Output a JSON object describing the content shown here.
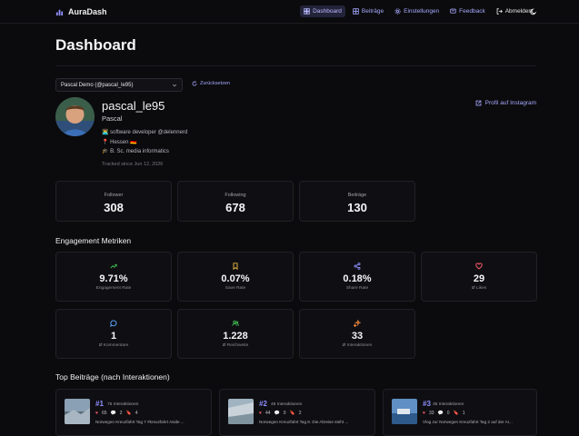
{
  "nav": {
    "brand": "AuraDash",
    "links": [
      {
        "label": "Dashboard",
        "icon": "dashboard-icon"
      },
      {
        "label": "Beiträge",
        "icon": "grid-icon"
      },
      {
        "label": "Einstellungen",
        "icon": "gear-icon"
      },
      {
        "label": "Feedback",
        "icon": "message-icon"
      },
      {
        "label": "Abmelden",
        "icon": "logout-icon"
      }
    ],
    "theme_icon": "moon-icon"
  },
  "page_title": "Dashboard",
  "account_select": {
    "value": "Pascal Demo (@pascal_le95)"
  },
  "reset_label": "Zurücksetzen",
  "profile": {
    "username": "pascal_le95",
    "name": "Pascal",
    "bio": [
      "👨‍💻 software developer @delennerd",
      "📍 Hessen 🇩🇪",
      "🎓 B. Sc. media informatics"
    ],
    "tracked": "Tracked since Jun 12, 2026",
    "instagram_link": "Profil auf Instagram"
  },
  "stats": [
    {
      "label": "Follower",
      "value": "308"
    },
    {
      "label": "Following",
      "value": "678"
    },
    {
      "label": "Beiträge",
      "value": "130"
    }
  ],
  "engagement_title": "Engagement Metriken",
  "metrics": [
    {
      "label": "Engagement Rate",
      "value": "9.71%",
      "icon": "trend-up-icon",
      "color": "#3fb950"
    },
    {
      "label": "Save Rate",
      "value": "0.07%",
      "icon": "bookmark-icon",
      "color": "#e3b341"
    },
    {
      "label": "Share Rate",
      "value": "0.18%",
      "icon": "share-icon",
      "color": "#8f90ff"
    },
    {
      "label": "Ø Likes",
      "value": "29",
      "icon": "heart-icon",
      "color": "#ff5a6a"
    },
    {
      "label": "Ø Kommentare",
      "value": "1",
      "icon": "comment-icon",
      "color": "#58a6ff"
    },
    {
      "label": "Ø Reichweite",
      "value": "1.228",
      "icon": "users-icon",
      "color": "#3fb950"
    },
    {
      "label": "Ø Interaktionen",
      "value": "33",
      "icon": "sparkle-icon",
      "color": "#f0883e"
    }
  ],
  "top_posts_title": "Top Beiträge (nach Interaktionen)",
  "posts": [
    {
      "rank": "#1",
      "interactions": "75 Interaktionen",
      "likes": "65",
      "comments": "2",
      "saves": "4",
      "title": "Norwegen Kreuzfahrt Tag 7 #kreuzfahrt Aside ..."
    },
    {
      "rank": "#2",
      "interactions": "48 Interaktionen",
      "likes": "44",
      "comments": "0",
      "saves": "2",
      "title": "Norwegen Kreuzfahrt Tag 8. Die Abreise steht ..."
    },
    {
      "rank": "#3",
      "interactions": "36 Interaktionen",
      "likes": "33",
      "comments": "0",
      "saves": "1",
      "title": "Vlog zur Norwegen Kreuzfahrt Tag 2 auf der AI..."
    }
  ]
}
